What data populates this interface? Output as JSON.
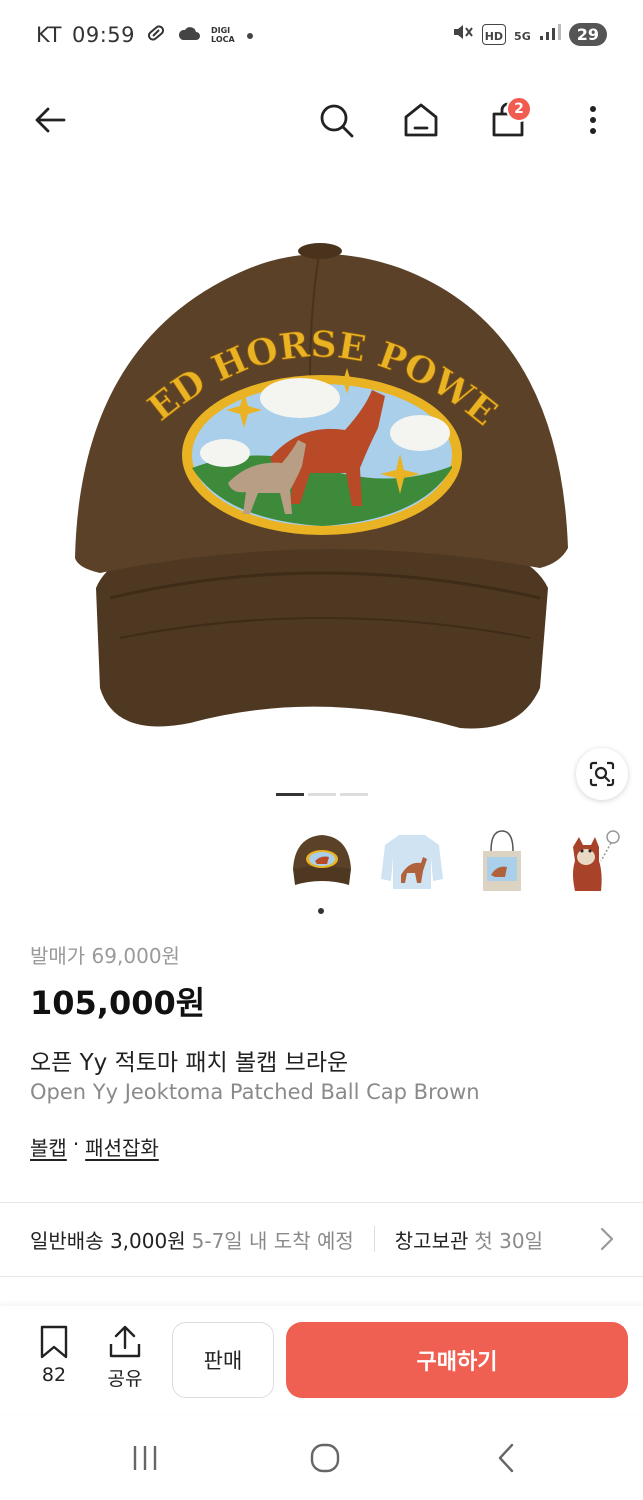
{
  "status_bar": {
    "carrier": "KT",
    "time": "09:59",
    "digi_top": "DIGI",
    "digi_bottom": "LOCA",
    "network_hd": "HD",
    "network_5g": "5G",
    "battery": "29"
  },
  "top_nav": {
    "cart_count": "2"
  },
  "gallery": {
    "page_count": 3,
    "active_page": 1
  },
  "product": {
    "release_price": "발매가 69,000원",
    "price": "105,000원",
    "name_ko": "오픈 Yy 적토마 패치 볼캡 브라운",
    "name_en": "Open Yy Jeoktoma Patched Ball Cap Brown",
    "category_1": "볼캡",
    "category_separator": "·",
    "category_2": "패션잡화"
  },
  "shipping": {
    "standard_main": "일반배송 3,000원",
    "standard_sub": "5-7일 내 도착 예정",
    "storage_main": "창고보관",
    "storage_sub": "첫 30일"
  },
  "action_bar": {
    "bookmark_count": "82",
    "share_label": "공유",
    "sell_label": "판매",
    "buy_label": "구매하기"
  },
  "colors": {
    "accent": "#ef5f52",
    "badge": "#f15b50",
    "cap_brown": "#5a4127",
    "patch_yellow": "#e9b324"
  }
}
